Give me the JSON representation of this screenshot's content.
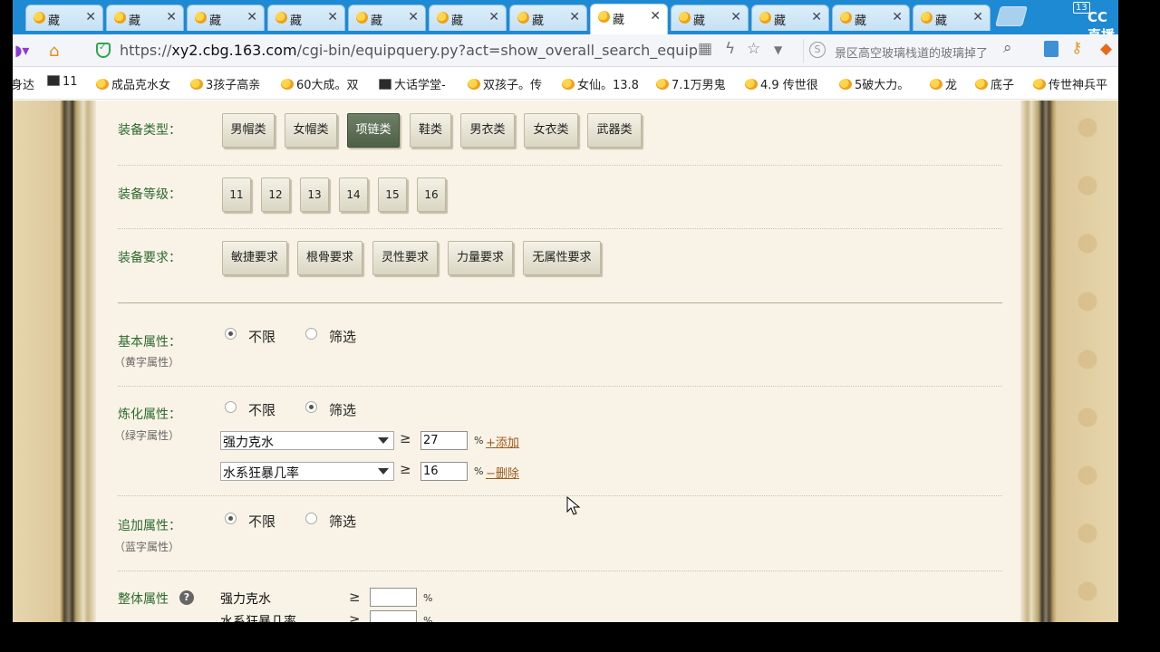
{
  "browser": {
    "tabs": [
      {
        "label": "藏"
      },
      {
        "label": "藏"
      },
      {
        "label": "藏"
      },
      {
        "label": "藏"
      },
      {
        "label": "藏"
      },
      {
        "label": "藏"
      },
      {
        "label": "藏"
      },
      {
        "label": "藏"
      },
      {
        "label": "藏"
      },
      {
        "label": "藏"
      },
      {
        "label": "藏"
      },
      {
        "label": "藏"
      }
    ],
    "tab_close": "✕",
    "overlay": {
      "badge": "13",
      "logo": "CC直播"
    },
    "address": {
      "host": "xy2.cbg.163.com",
      "scheme": "https://",
      "path": "/cgi-bin/equipquery.py?act=show_overall_search_equip",
      "search_text": "景区高空玻璃栈道的玻璃掉了"
    },
    "bookmarks": [
      {
        "label": "身达"
      },
      {
        "label": "11"
      },
      {
        "label": "成品克水女"
      },
      {
        "label": "3孩子高亲"
      },
      {
        "label": "60大成。双"
      },
      {
        "label": "大话学堂-"
      },
      {
        "label": "双孩子。传"
      },
      {
        "label": "女仙。13.8"
      },
      {
        "label": "7.1万男鬼"
      },
      {
        "label": "4.9 传世很"
      },
      {
        "label": "5破大力。"
      },
      {
        "label": "龙"
      },
      {
        "label": "底子"
      },
      {
        "label": "传世神兵平"
      }
    ]
  },
  "form": {
    "equip_type": {
      "label": "装备类型：",
      "options": [
        "男帽类",
        "女帽类",
        "项链类",
        "鞋类",
        "男衣类",
        "女衣类",
        "武器类"
      ],
      "selected": "项链类"
    },
    "equip_level": {
      "label": "装备等级：",
      "options": [
        "11",
        "12",
        "13",
        "14",
        "15",
        "16"
      ]
    },
    "equip_req": {
      "label": "装备要求：",
      "options": [
        "敏捷要求",
        "根骨要求",
        "灵性要求",
        "力量要求",
        "无属性要求"
      ]
    },
    "basic_attr": {
      "label": "基本属性：",
      "sub": "（黄字属性）",
      "opt_unlimited": "不限",
      "opt_filter": "筛选",
      "selected": "unlimited"
    },
    "refine_attr": {
      "label": "炼化属性：",
      "sub": "（绿字属性）",
      "opt_unlimited": "不限",
      "opt_filter": "筛选",
      "selected": "filter",
      "rows": [
        {
          "select": "强力克水",
          "geq": "≥",
          "value": "27",
          "unit": "%",
          "action": "+添加"
        },
        {
          "select": "水系狂暴几率",
          "geq": "≥",
          "value": "16",
          "unit": "%",
          "action": "−删除"
        }
      ]
    },
    "extra_attr": {
      "label": "追加属性：",
      "sub": "（蓝字属性）",
      "opt_unlimited": "不限",
      "opt_filter": "筛选",
      "selected": "unlimited"
    },
    "overall_attr": {
      "label": "整体属性",
      "help": "?",
      "rows": [
        {
          "name": "强力克水",
          "geq": "≥",
          "value": "",
          "unit": "%"
        },
        {
          "name": "水系狂暴几率",
          "geq": "≥",
          "value": "",
          "unit": "%"
        }
      ]
    }
  }
}
